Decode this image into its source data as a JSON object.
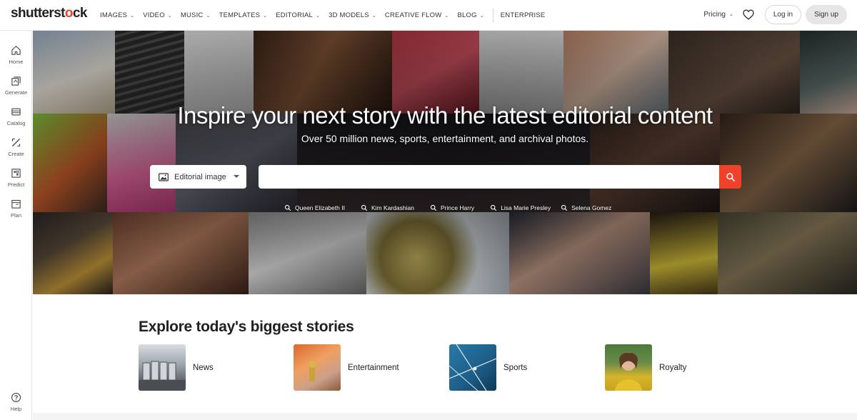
{
  "brand": {
    "logo_text_a": "shutterst",
    "logo_text_b": "ck",
    "accent": "#f0412b"
  },
  "nav": {
    "links": [
      {
        "label": "IMAGES",
        "dropdown": true
      },
      {
        "label": "VIDEO",
        "dropdown": true
      },
      {
        "label": "MUSIC",
        "dropdown": true
      },
      {
        "label": "TEMPLATES",
        "dropdown": true
      },
      {
        "label": "EDITORIAL",
        "dropdown": true
      },
      {
        "label": "3D MODELS",
        "dropdown": true
      },
      {
        "label": "CREATIVE FLOW",
        "dropdown": true
      },
      {
        "label": "BLOG",
        "dropdown": true
      }
    ],
    "enterprise": "ENTERPRISE",
    "pricing": "Pricing",
    "login": "Log in",
    "signup": "Sign up"
  },
  "sidebar": {
    "items": [
      {
        "label": "Home",
        "icon": "home-icon"
      },
      {
        "label": "Generate",
        "icon": "generate-icon"
      },
      {
        "label": "Catalog",
        "icon": "catalog-icon"
      },
      {
        "label": "Create",
        "icon": "create-icon"
      },
      {
        "label": "Predict",
        "icon": "predict-icon"
      },
      {
        "label": "Plan",
        "icon": "plan-icon"
      }
    ],
    "help": "Help"
  },
  "hero": {
    "title": "Inspire your next story with the latest editorial content",
    "subtitle": "Over 50 million news, sports, entertainment, and archival photos.",
    "search_type": "Editorial image",
    "search_placeholder": "",
    "trending": [
      "Queen Elizabeth II",
      "Kim Kardashian",
      "Prince Harry",
      "Lisa Marie Presley",
      "Selena Gomez"
    ]
  },
  "stories": {
    "title": "Explore today's biggest stories",
    "items": [
      {
        "label": "News"
      },
      {
        "label": "Entertainment"
      },
      {
        "label": "Sports"
      },
      {
        "label": "Royalty"
      }
    ]
  }
}
